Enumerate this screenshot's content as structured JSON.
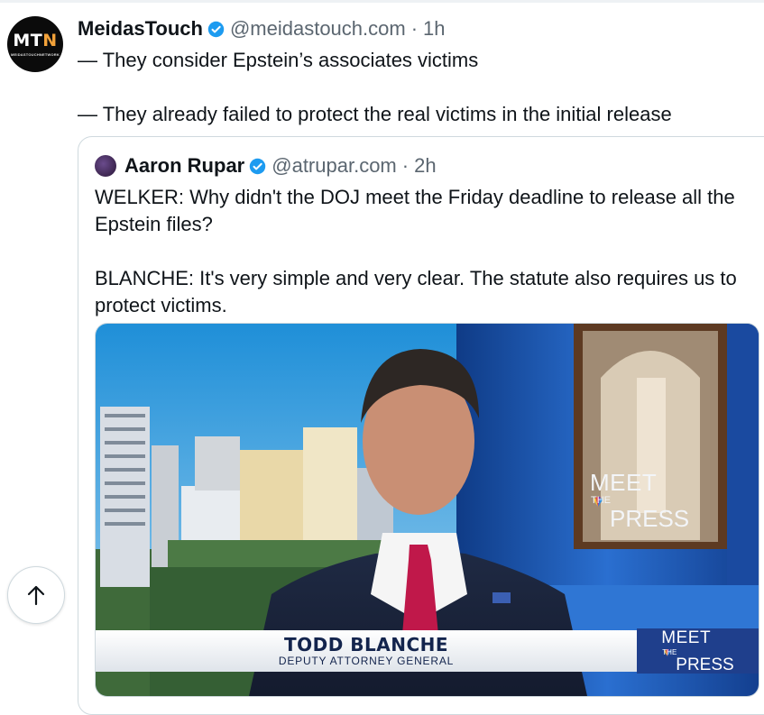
{
  "post": {
    "author_name": "MeidasTouch",
    "handle": "@meidastouch.com",
    "separator": "·",
    "time": "1h",
    "avatar_text": "MTN",
    "avatar_subtext": "MEIDASTOUCHNETWORK",
    "lines": [
      "— They consider Epstein’s associates victims",
      "— They already failed to protect the real victims in the initial release"
    ]
  },
  "quote": {
    "author_name": "Aaron Rupar",
    "handle": "@atrupar.com",
    "separator": "·",
    "time": "2h",
    "paragraphs": [
      "WELKER: Why didn't the DOJ meet the Friday deadline to release all the Epstein files?",
      "BLANCHE: It's very simple and very clear. The statute also requires us to protect victims."
    ],
    "media": {
      "lower_third_name": "TODD BLANCHE",
      "lower_third_title": "DEPUTY ATTORNEY GENERAL",
      "logo_meet": "MEET",
      "logo_the": "THE",
      "logo_press": "PRESS"
    }
  },
  "controls": {
    "scroll_top_icon": "arrow-up-icon",
    "verified_icon": "verified-badge-icon"
  },
  "colors": {
    "verified": "#1d9bf0",
    "secondary_text": "#5b6670",
    "border": "#cfd9de",
    "nbc_blue": "#1f3f8c"
  }
}
